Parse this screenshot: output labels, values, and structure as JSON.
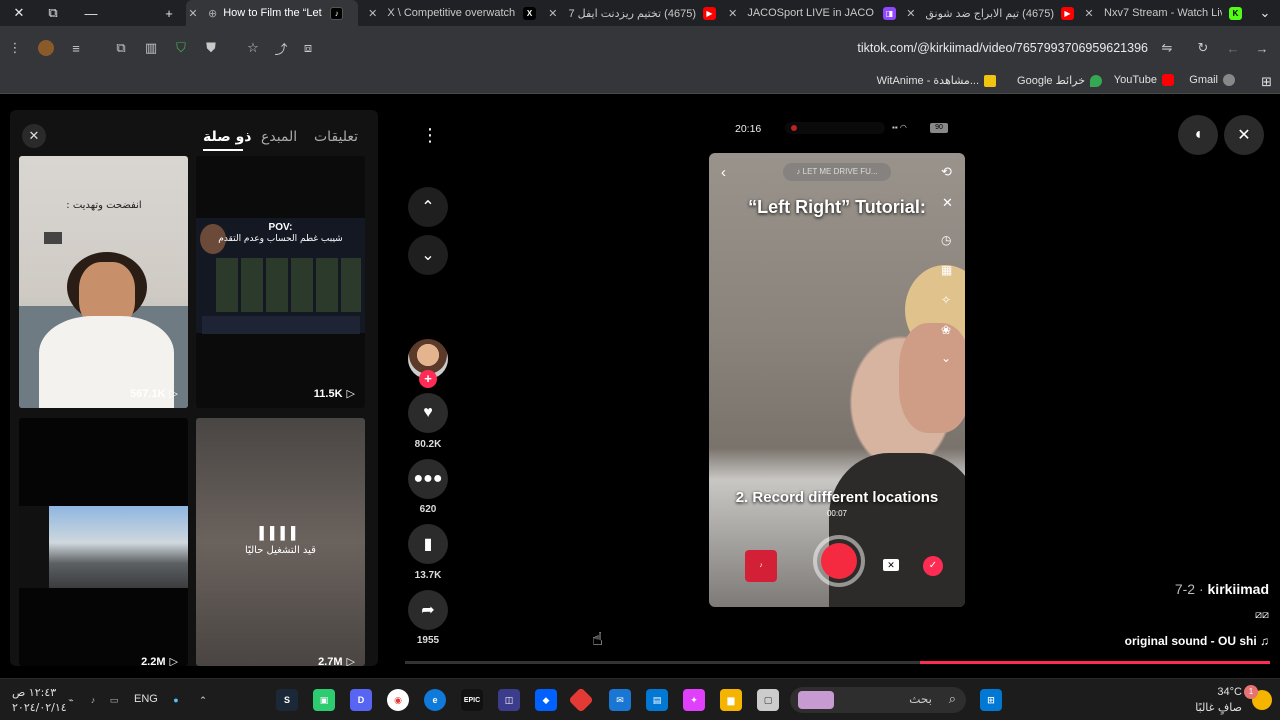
{
  "browser": {
    "window_controls": [
      "✕",
      "⧉",
      "—",
      "+"
    ],
    "tabs": [
      {
        "title": "How to Film the “Let M",
        "icon": "tiktok-icon",
        "icon_color": "#000000",
        "active": true
      },
      {
        "title": "X \\ Competitive overwatch",
        "icon": "x-icon",
        "icon_color": "#000000",
        "active": false
      },
      {
        "title": "(4675) تختيم ريزدنت ايفل 7",
        "icon": "youtube-icon",
        "icon_color": "#ff0000",
        "active": false
      },
      {
        "title": "JACOSport LIVE in JACO -",
        "icon": "twitch-icon",
        "icon_color": "#9146ff",
        "active": false
      },
      {
        "title": "(4675) تيم الابراج ضد شونق",
        "icon": "youtube-icon",
        "icon_color": "#ff0000",
        "active": false
      },
      {
        "title": "Nxv7 Stream - Watch Live",
        "icon": "kick-icon",
        "icon_color": "#53fc18",
        "active": false
      }
    ],
    "url": "tiktok.com/@kirkiimad/video/7657993706959621396",
    "bookmarks": [
      {
        "label": "WitAnime - مشاهدة...",
        "color": "#f1c40f"
      },
      {
        "label": "Google خرائط",
        "color": "#34a853"
      },
      {
        "label": "YouTube",
        "color": "#ff0000"
      },
      {
        "label": "Gmail",
        "color": "#888888"
      }
    ]
  },
  "panel": {
    "close": "✕",
    "tabs": [
      "تعليقات",
      "المبدع",
      "ذو صلة"
    ],
    "active_tab": "ذو صلة",
    "thumbnails": [
      {
        "caption": ": انفضحت وتهديت",
        "views": "567.1K"
      },
      {
        "caption_title": "POV:",
        "caption": "شيبب غطم الحساب وعدم التقدم",
        "views": "11.5K"
      },
      {
        "caption": "",
        "views": "2.2M"
      },
      {
        "caption": "قيد التشغيل حاليًا",
        "views": "2.7M"
      }
    ]
  },
  "actions": {
    "likes": "80.2K",
    "comments": "620",
    "saves": "13.7K",
    "shares": "1955"
  },
  "video": {
    "status_time": "20:16",
    "battery": "90",
    "music_pill": "♪ LET ME DRIVE FU...",
    "title_text": "“Left Right” Tutorial:",
    "step_text": "2. Record different locations",
    "timer": "00:07",
    "author": "kirkiimad",
    "date": "7-2",
    "sound": "original sound - OU shi"
  },
  "taskbar": {
    "time": "١٢:٤٣ ص",
    "date": "٢٠٢٤/٠٢/١٤",
    "lang": "ENG",
    "search": "بحث",
    "weather_temp": "34°C",
    "weather_desc": "صافٍ غالبًا",
    "notif": "1"
  }
}
